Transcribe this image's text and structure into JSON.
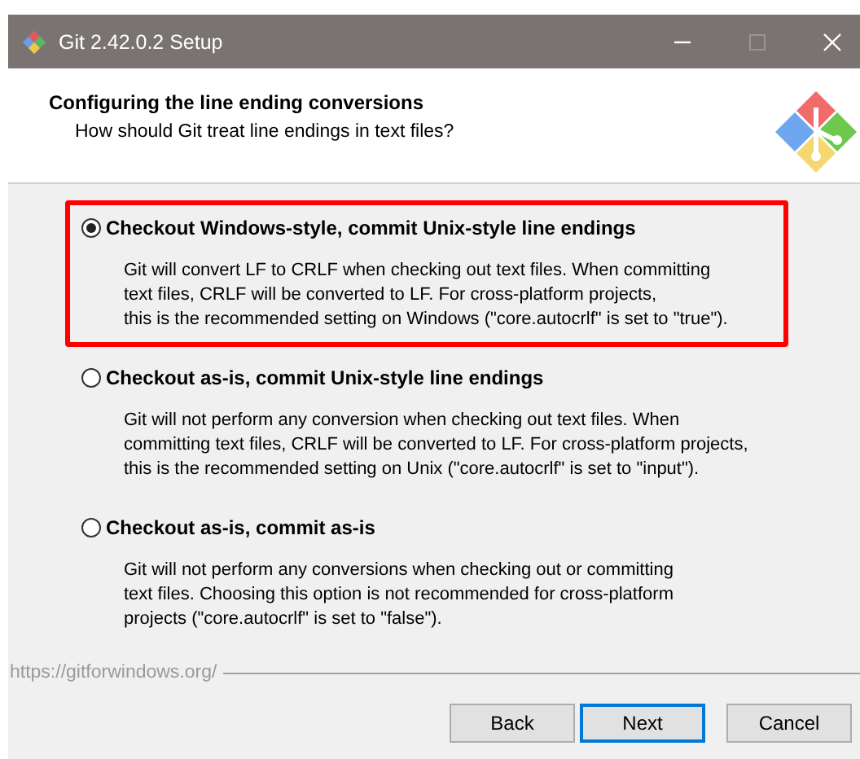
{
  "window": {
    "title": "Git 2.42.0.2 Setup"
  },
  "header": {
    "title": "Configuring the line ending conversions",
    "subtitle": "How should Git treat line endings in text files?"
  },
  "options": [
    {
      "label": "Checkout Windows-style, commit Unix-style line endings",
      "selected": true,
      "highlighted": true,
      "description": [
        "Git will convert LF to CRLF when checking out text files. When committing",
        "text files, CRLF will be converted to LF. For cross-platform projects,",
        "this is the recommended setting on Windows (\"core.autocrlf\" is set to \"true\")."
      ]
    },
    {
      "label": "Checkout as-is, commit Unix-style line endings",
      "selected": false,
      "highlighted": false,
      "description": [
        "Git will not perform any conversion when checking out text files. When",
        "committing text files, CRLF will be converted to LF. For cross-platform projects,",
        "this is the recommended setting on Unix (\"core.autocrlf\" is set to \"input\")."
      ]
    },
    {
      "label": "Checkout as-is, commit as-is",
      "selected": false,
      "highlighted": false,
      "description": [
        "Git will not perform any conversions when checking out or committing",
        "text files. Choosing this option is not recommended for cross-platform",
        "projects (\"core.autocrlf\" is set to \"false\")."
      ]
    }
  ],
  "footer": {
    "url": "https://gitforwindows.org/"
  },
  "buttons": [
    {
      "label": "Back",
      "default": false
    },
    {
      "label": "Next",
      "default": true
    },
    {
      "label": "Cancel",
      "default": false
    }
  ]
}
